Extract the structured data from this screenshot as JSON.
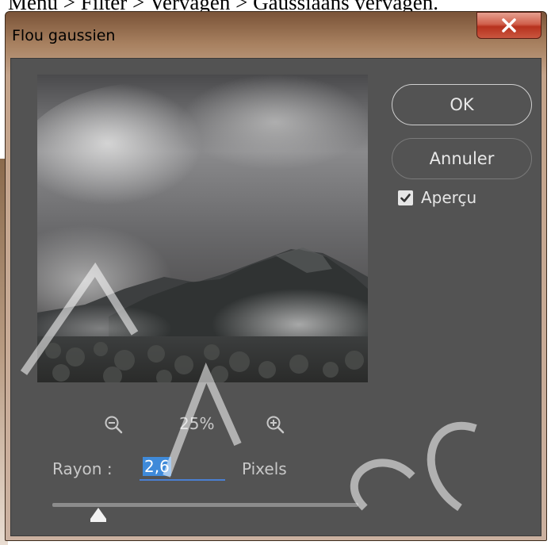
{
  "caption": "Menu > Filter > Vervagen > Gaussiaans vervagen.",
  "window": {
    "title": "Flou gaussien",
    "close_glyph": "x"
  },
  "buttons": {
    "ok_label": "OK",
    "cancel_label": "Annuler"
  },
  "preview_checkbox": {
    "label": "Aperçu",
    "checked": true
  },
  "zoom": {
    "level": "25%",
    "zoom_out_icon": "zoom-out-icon",
    "zoom_in_icon": "zoom-in-icon"
  },
  "radius": {
    "label": "Rayon :",
    "value": "2,6",
    "units": "Pixels"
  },
  "slider": {
    "value_fraction": 0.15
  },
  "colors": {
    "dialog_bg": "#535353",
    "accent": "#3f8ad9",
    "close_red": "#c9563f"
  }
}
